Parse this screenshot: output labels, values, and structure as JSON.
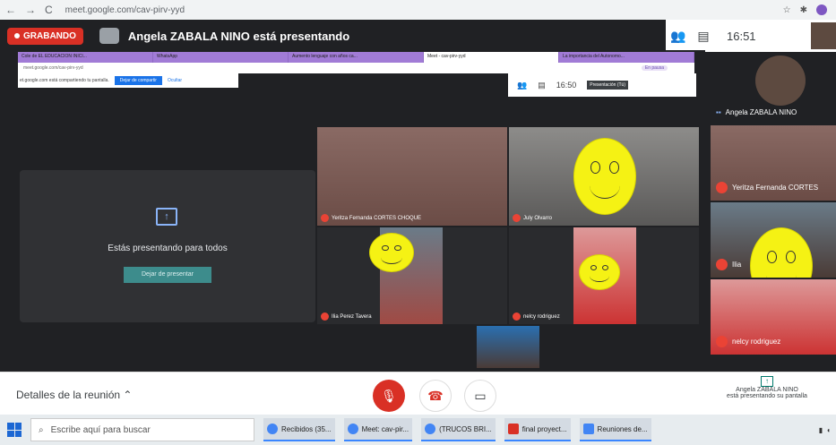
{
  "browser": {
    "url": "meet.google.com/cav-pirv-yyd"
  },
  "meet": {
    "recording_label": "GRABANDO",
    "presenting_title": "Angela ZABALA NINO está presentando",
    "time": "16:51"
  },
  "inner_browser": {
    "tabs": [
      "Cole de EL EDUCACION INICI...",
      "WhatsApp",
      "Aumento lenguaje con años ca...",
      "Meet - cav-pirv-yyd",
      "La importancia del Autonomo..."
    ],
    "url": "meet.google.com/cav-pirv-yyd",
    "paused_label": "En pausa",
    "share_notice": "et.google.com está compartiendo tu pantalla.",
    "stop_share_label": "Dejar de compartir",
    "hide_label": "Ocultar",
    "time": "16:50",
    "presentation_badge": "Presentación (Tú)"
  },
  "present_panel": {
    "text": "Estás presentando para todos",
    "stop_button": "Dejar de presentar"
  },
  "tiles": [
    {
      "name": "Yeritza Fernanda CORTES CHOQUE"
    },
    {
      "name": "July Olvarro"
    },
    {
      "name": "Ilia Perez Tavera"
    },
    {
      "name": "nelcy rodriguez"
    }
  ],
  "sidebar": {
    "tiles": [
      {
        "name": "Angela ZABALA NINO"
      },
      {
        "name": "Yeritza Fernanda CORTES"
      },
      {
        "name": "Ilia"
      },
      {
        "name": "nelcy rodriguez"
      }
    ]
  },
  "controls": {
    "details_label": "Detalles de la reunión",
    "presenter_name": "Angela ZABALA NINO",
    "presenter_sub": "está presentando su pantalla"
  },
  "taskbar": {
    "search_placeholder": "Escribe aquí para buscar",
    "items": [
      "Recibidos (35...",
      "Meet: cav-pir...",
      "(TRUCOS BRI...",
      "final proyect...",
      "Reuniones de..."
    ]
  }
}
